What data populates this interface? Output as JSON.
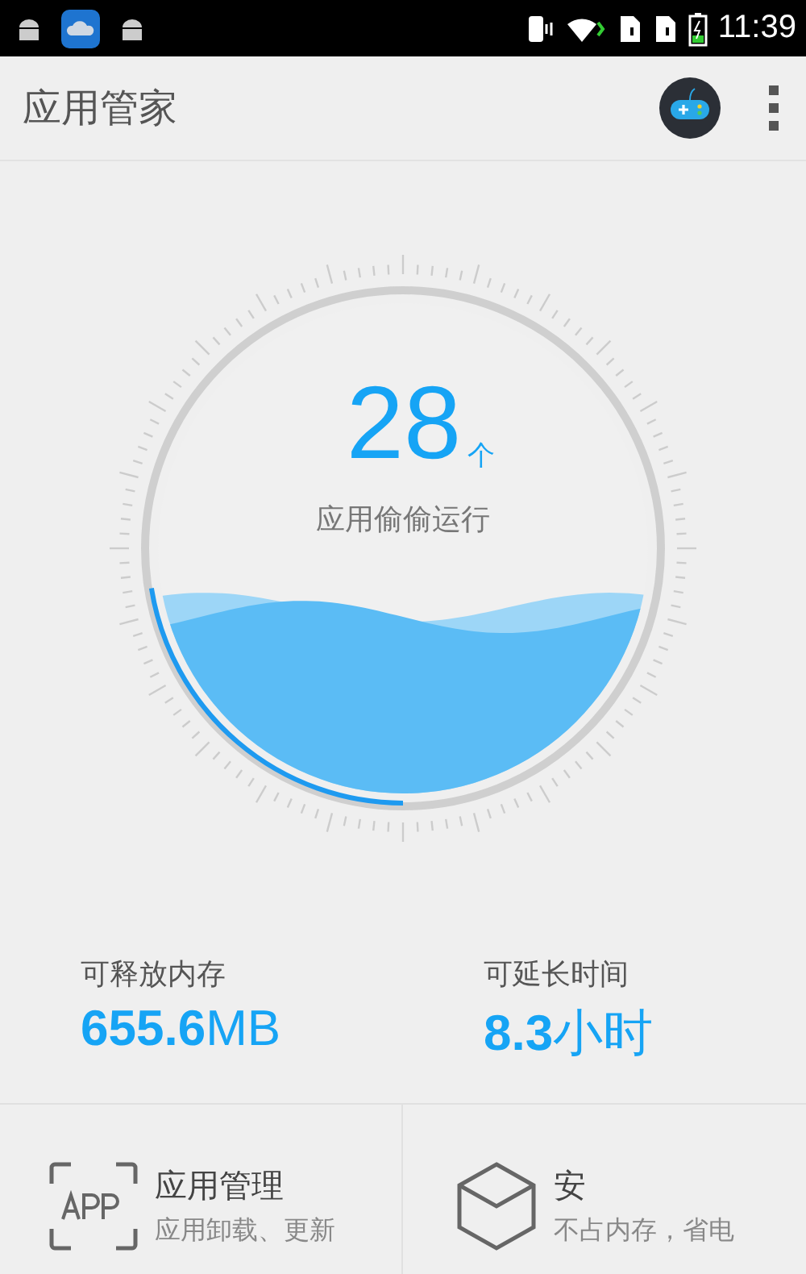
{
  "status_bar": {
    "time": "11:39"
  },
  "app_bar": {
    "title": "应用管家"
  },
  "gauge": {
    "count": "28",
    "unit": "个",
    "caption": "应用偷偷运行"
  },
  "stats": [
    {
      "label": "可释放内存",
      "value": "655.6",
      "unit": "MB"
    },
    {
      "label": "可延长时间",
      "value": "8.3",
      "unit": "小时"
    }
  ],
  "tiles": [
    {
      "kind": "app",
      "title": "应用管理",
      "subtitle": "应用卸载、更新"
    },
    {
      "kind": "hexagon",
      "title": "安",
      "subtitle": "不占内存，省电"
    }
  ]
}
